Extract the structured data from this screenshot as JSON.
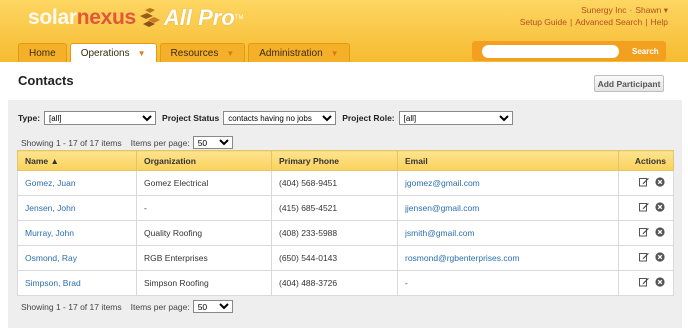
{
  "brand": {
    "solar": "solar",
    "nexus": "nexus",
    "allpro": "All Pro",
    "tm": "TM"
  },
  "user": {
    "company": "Sunergy Inc",
    "name": "Shawn",
    "setup": "Setup Guide",
    "advanced": "Advanced Search",
    "help": "Help"
  },
  "nav": [
    {
      "label": "Home"
    },
    {
      "label": "Operations"
    },
    {
      "label": "Resources"
    },
    {
      "label": "Administration"
    }
  ],
  "search": {
    "button": "Search",
    "value": ""
  },
  "page": {
    "title": "Contacts",
    "add_button": "Add Participant"
  },
  "filters": {
    "type_label": "Type:",
    "type_value": "[all]",
    "status_label": "Project Status",
    "status_value": "contacts having no jobs",
    "role_label": "Project Role:",
    "role_value": "[all]"
  },
  "pager": {
    "showing": "Showing 1 - 17 of 17 items",
    "ipp_label": "Items per page:",
    "ipp_value": "50"
  },
  "table": {
    "headers": [
      "Name",
      "Organization",
      "Primary Phone",
      "Email",
      "Actions"
    ],
    "rows": [
      {
        "name": "Gomez, Juan",
        "org": "Gomez Electrical",
        "phone": "(404) 568-9451",
        "email": "jgomez@gmail.com"
      },
      {
        "name": "Jensen, John",
        "org": "-",
        "phone": "(415) 685-4521",
        "email": "jjensen@gmail.com"
      },
      {
        "name": "Murray, John",
        "org": "Quality Roofing",
        "phone": "(408) 233-5988",
        "email": "jsmith@gmail.com"
      },
      {
        "name": "Osmond, Ray",
        "org": "RGB Enterprises",
        "phone": "(650) 544-0143",
        "email": "rosmond@rgbenterprises.com"
      },
      {
        "name": "Simpson, Brad",
        "org": "Simpson Roofing",
        "phone": "(404) 488-3726",
        "email": "-"
      }
    ]
  },
  "colors": {
    "accent": "#f5b02a",
    "link": "#2c6eb0",
    "brand_red": "#e2563a"
  }
}
